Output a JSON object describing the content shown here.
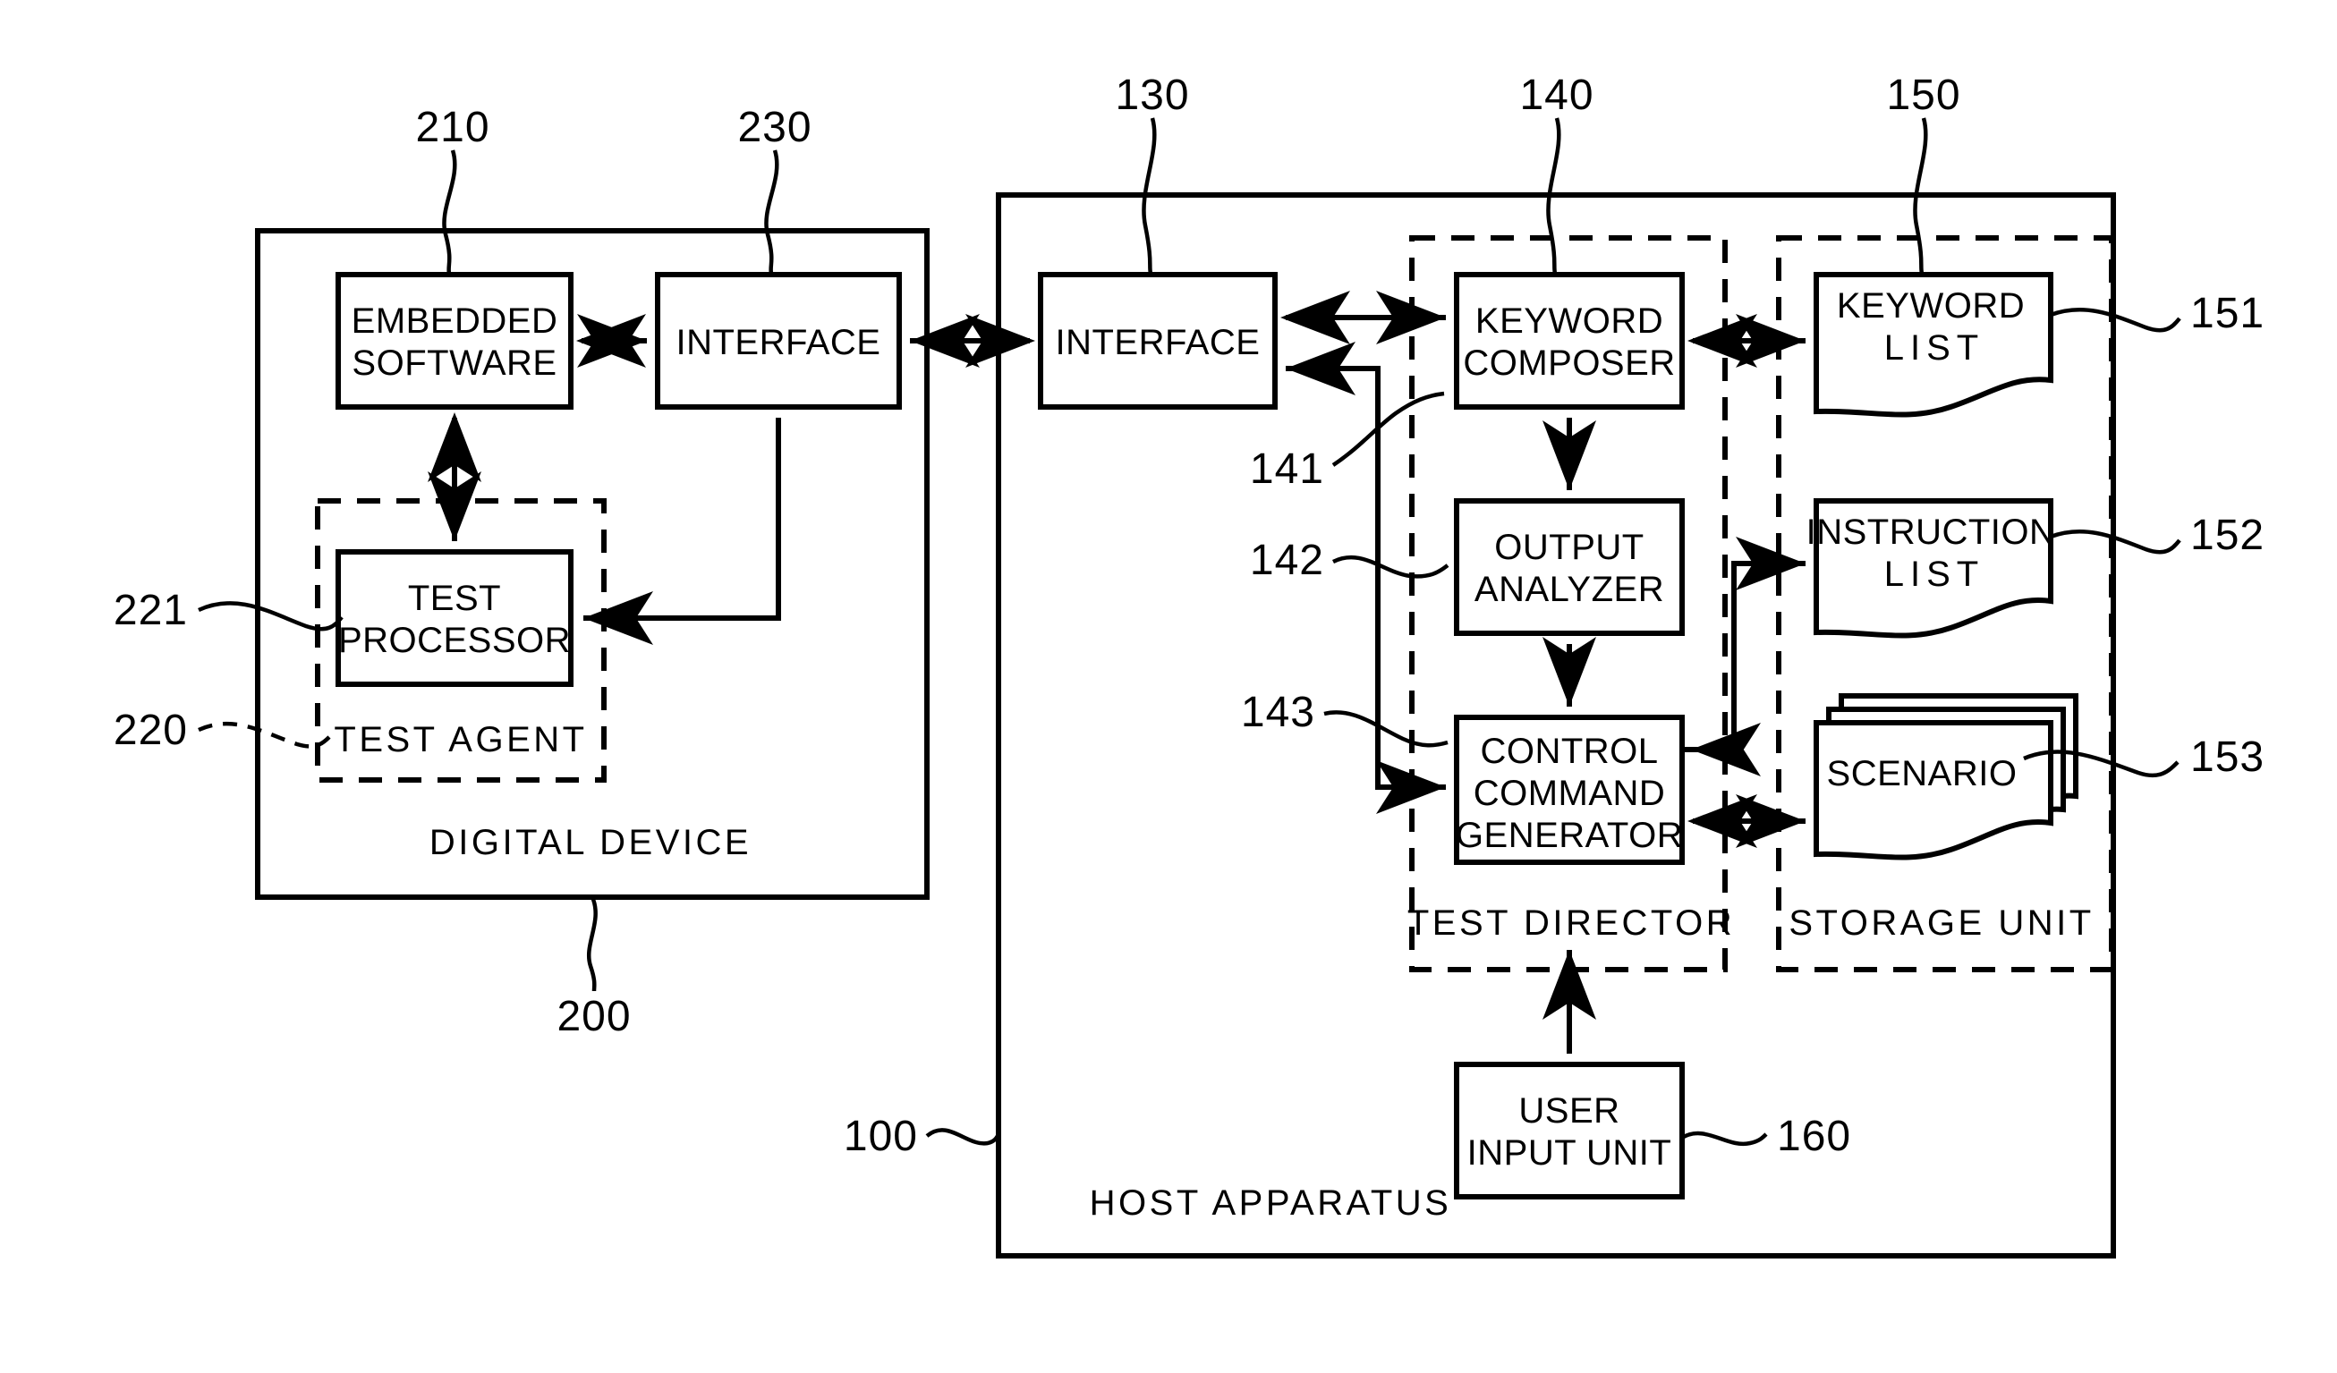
{
  "figure": {
    "title": "Test system block diagram",
    "ink_color": "#000000",
    "background_color": "#ffffff"
  },
  "digital_device": {
    "label": "DIGITAL DEVICE",
    "ref": "200",
    "embedded_software": {
      "line1": "EMBEDDED",
      "line2": "SOFTWARE",
      "ref": "210"
    },
    "interface": {
      "label": "INTERFACE",
      "ref": "230"
    },
    "test_agent": {
      "label": "TEST AGENT",
      "ref": "220",
      "test_processor": {
        "line1": "TEST",
        "line2": "PROCESSOR",
        "ref": "221"
      }
    }
  },
  "host_apparatus": {
    "label": "HOST APPARATUS",
    "ref": "100",
    "interface": {
      "label": "INTERFACE",
      "ref": "130"
    },
    "test_director": {
      "label": "TEST DIRECTOR",
      "ref": "140",
      "keyword_composer": {
        "line1": "KEYWORD",
        "line2": "COMPOSER",
        "ref": "141"
      },
      "output_analyzer": {
        "line1": "OUTPUT",
        "line2": "ANALYZER",
        "ref": "142"
      },
      "control_command_generator": {
        "line1": "CONTROL",
        "line2": "COMMAND",
        "line3": "GENERATOR",
        "ref": "143"
      }
    },
    "storage_unit": {
      "label": "STORAGE UNIT",
      "ref": "150",
      "keyword_list": {
        "line1": "KEYWORD",
        "line2": "LIST",
        "ref": "151"
      },
      "instruction_list": {
        "line1": "INSTRUCTION",
        "line2": "LIST",
        "ref": "152"
      },
      "scenario": {
        "label": "SCENARIO",
        "ref": "153"
      }
    },
    "user_input_unit": {
      "line1": "USER",
      "line2": "INPUT UNIT",
      "ref": "160"
    }
  }
}
